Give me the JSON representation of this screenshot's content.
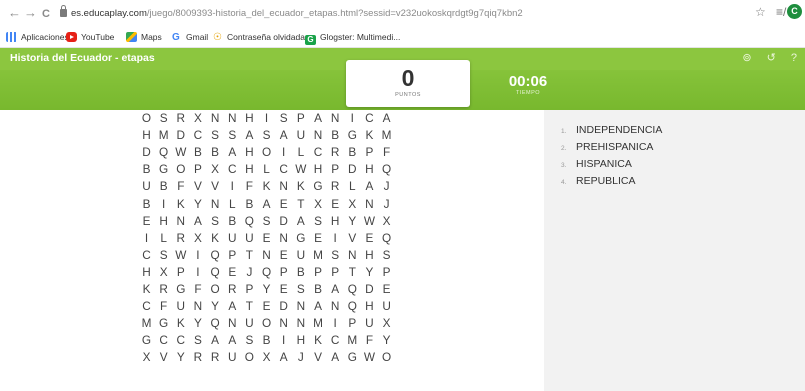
{
  "browser": {
    "back": "←",
    "forward": "→",
    "reload": "C",
    "url_domain": "es.educaplay.com",
    "url_path": "/juego/8009393-historia_del_ecuador_etapas.html?sessid=v232uokoskqrdgt9g7qiq7kbn2",
    "star": "☆",
    "menu": "≡/",
    "profile": "C"
  },
  "bookmarks": [
    {
      "label": "Aplicaciones",
      "icon": "apps-grid-icon"
    },
    {
      "label": "YouTube",
      "icon": "youtube-icon"
    },
    {
      "label": "Maps",
      "icon": "maps-icon"
    },
    {
      "label": "Gmail",
      "icon": "google-g-icon"
    },
    {
      "label": "Contraseña olvidada",
      "icon": "password-icon"
    },
    {
      "label": "Glogster: Multimedi...",
      "icon": "glogster-icon"
    }
  ],
  "app": {
    "title": "Historia del Ecuador - etapas",
    "icon_fullscreen": "⊚",
    "icon_restart": "↺",
    "icon_help": "?"
  },
  "score": {
    "value": "0",
    "label": "PUNTOS"
  },
  "timer": {
    "value": "00:06",
    "label": "TIEMPO"
  },
  "grid": [
    "OSRXNNHISPANICA",
    "HMDCSSASAUNBGKM",
    "DQWBBAHOILCRBPF",
    "BGOPXCHLCWHPDHQ",
    "UBFVVIFKNKGRLAJ",
    "BIKYNLBAETXEXNJ",
    "EHNASBQSDASHYWX",
    "ILRXKUUENGEIVEQ",
    "CSWIQPTNEUMSNHS",
    "HXPIQEJQPBPPTYP",
    "KRGFORPYESBAQDE",
    "CFUNYATEDNANQHU",
    "MGKYQNUONNMIPUX",
    "GCCSAASBIHKCMFY",
    "XVYRRUOXAJVAGWO"
  ],
  "words": [
    {
      "num": "1.",
      "text": "INDEPENDENCIA"
    },
    {
      "num": "2.",
      "text": "PREHISPANICA"
    },
    {
      "num": "3.",
      "text": "HISPANICA"
    },
    {
      "num": "4.",
      "text": "REPUBLICA"
    }
  ]
}
